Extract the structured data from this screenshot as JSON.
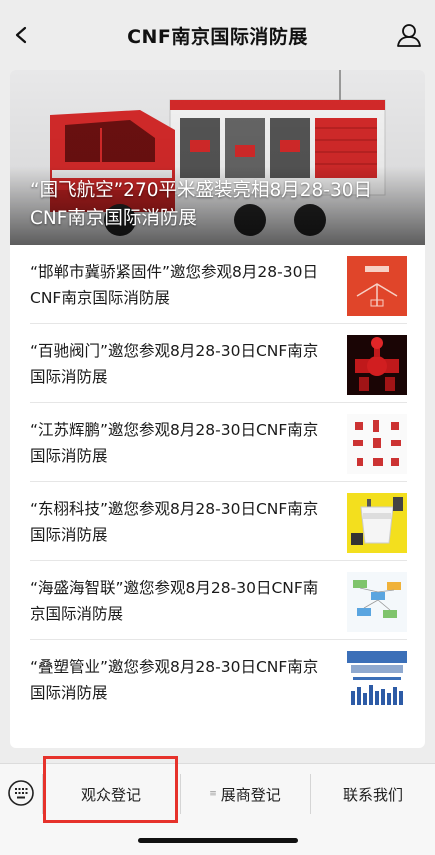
{
  "nav": {
    "title": "CNF南京国际消防展"
  },
  "hero": {
    "caption": "“国飞航空”270平米盛装亮相8月28-30日CNF南京国际消防展"
  },
  "articles": [
    {
      "title": "“邯郸市冀骄紧固件”邀您参观8月28-30日CNF南京国际消防展",
      "thumb": "red-fire-pipe-diagram"
    },
    {
      "title": "“百驰阀门”邀您参观8月28-30日CNF南京国际消防展",
      "thumb": "red-valves"
    },
    {
      "title": "“江苏辉鹏”邀您参观8月28-30日CNF南京国际消防展",
      "thumb": "fire-fittings-catalog"
    },
    {
      "title": "“东栩科技”邀您参观8月28-30日CNF南京国际消防展",
      "thumb": "white-device"
    },
    {
      "title": "“海盛海智联”邀您参观8月28-30日CNF南京国际消防展",
      "thumb": "network-diagram"
    },
    {
      "title": "“叠塑管业”邀您参观8月28-30日CNF南京国际消防展",
      "thumb": "pipe-factory"
    }
  ],
  "tabbar": {
    "tabs": [
      {
        "label": "观众登记"
      },
      {
        "label": "展商登记"
      },
      {
        "label": "联系我们"
      }
    ]
  },
  "colors": {
    "highlight": "#e6322b",
    "fire_red": "#d42a2a"
  }
}
